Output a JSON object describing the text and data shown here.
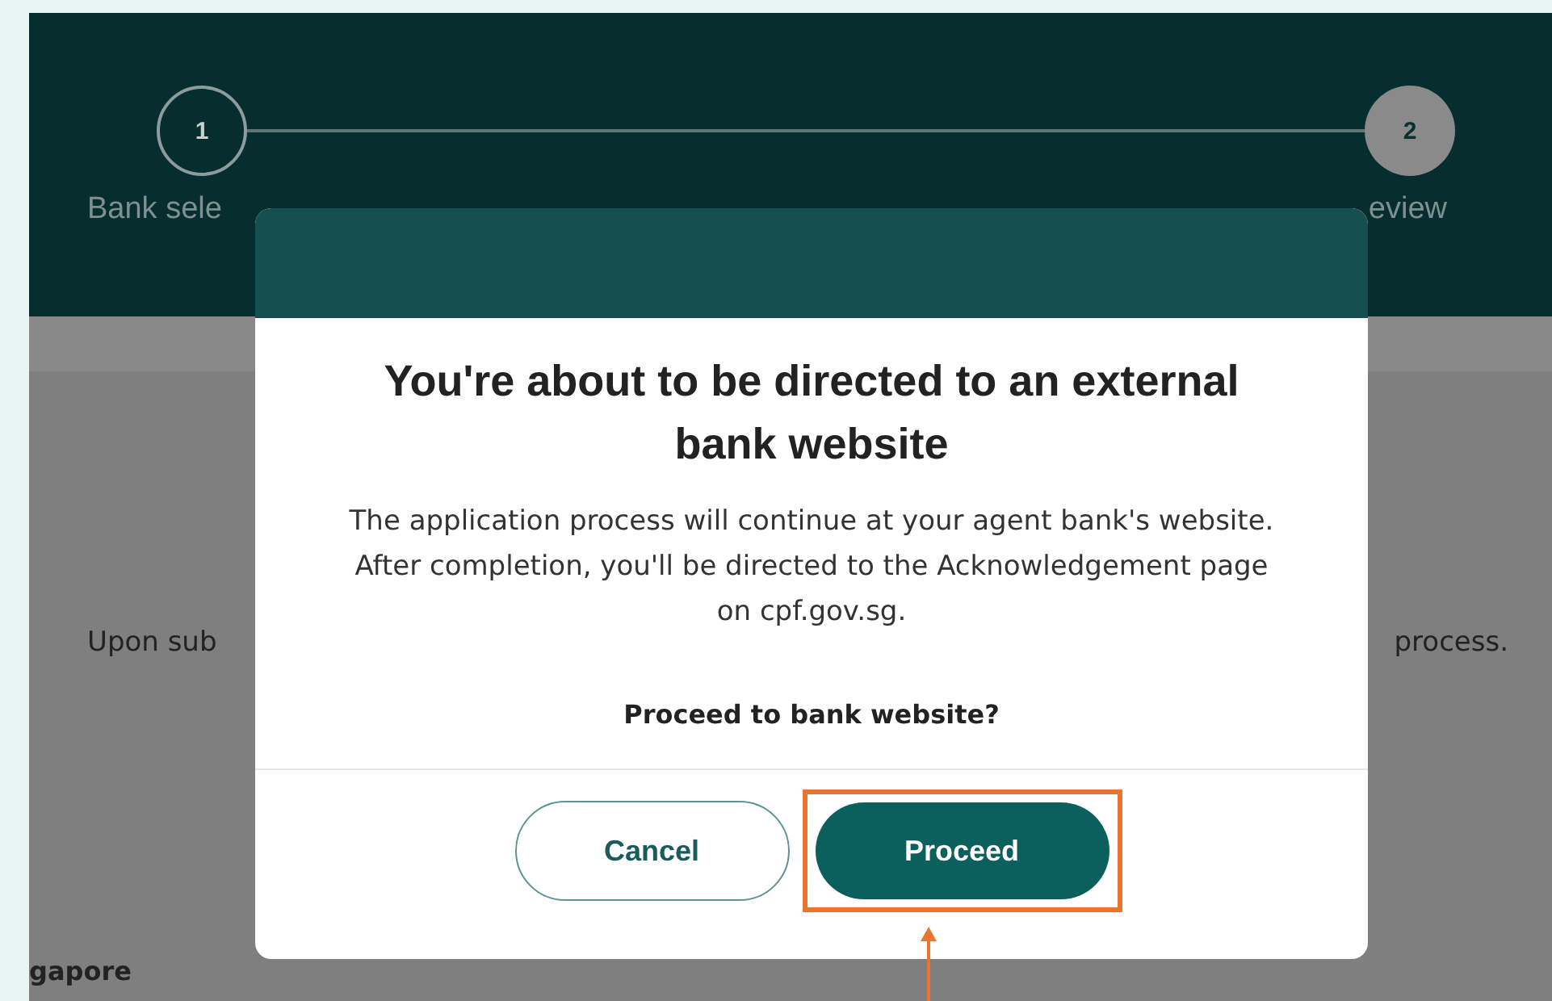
{
  "stepper": {
    "steps": [
      {
        "number": "1",
        "label": "Bank sele",
        "filled": false
      },
      {
        "number": "2",
        "label": "eview",
        "filled": true
      }
    ]
  },
  "page": {
    "text_left": "Upon sub",
    "text_right": "process.",
    "footer_text": "gapore"
  },
  "dialog": {
    "title": "You're about to be directed to an external bank website",
    "message": "The application process will continue at your agent bank's website. After completion, you'll be directed to the Acknowledgement page on cpf.gov.sg.",
    "question": "Proceed to bank website?",
    "buttons": [
      {
        "label": "Cancel",
        "kind": "secondary",
        "highlighted": false
      },
      {
        "label": "Proceed",
        "kind": "primary",
        "highlighted": true
      }
    ]
  }
}
